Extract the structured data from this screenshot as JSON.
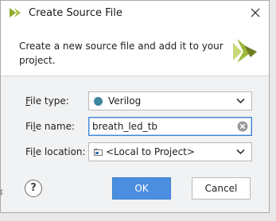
{
  "window": {
    "title": "Create Source File",
    "close_icon": "close-icon",
    "app_icon": "vivado-icon"
  },
  "header": {
    "description": "Create a new source file and add it to your project."
  },
  "form": {
    "file_type": {
      "label_prefix": "F",
      "label_rest": "ile type:",
      "value": "Verilog",
      "dot_color": "#3f86a0"
    },
    "file_name": {
      "label_prefix": "Fi",
      "label_underlined": "l",
      "label_rest": "e name:",
      "value": "breath_led_tb"
    },
    "file_location": {
      "label_prefix": "Fi",
      "label_underlined": "l",
      "label_rest": "e location:",
      "value": "<Local to Project>"
    }
  },
  "buttons": {
    "help": "?",
    "ok": "OK",
    "cancel": "Cancel"
  },
  "colors": {
    "accent": "#4b8ee0",
    "logo_green": "#9bb93a",
    "logo_olive": "#6e7e21"
  },
  "background_fragment": "p"
}
